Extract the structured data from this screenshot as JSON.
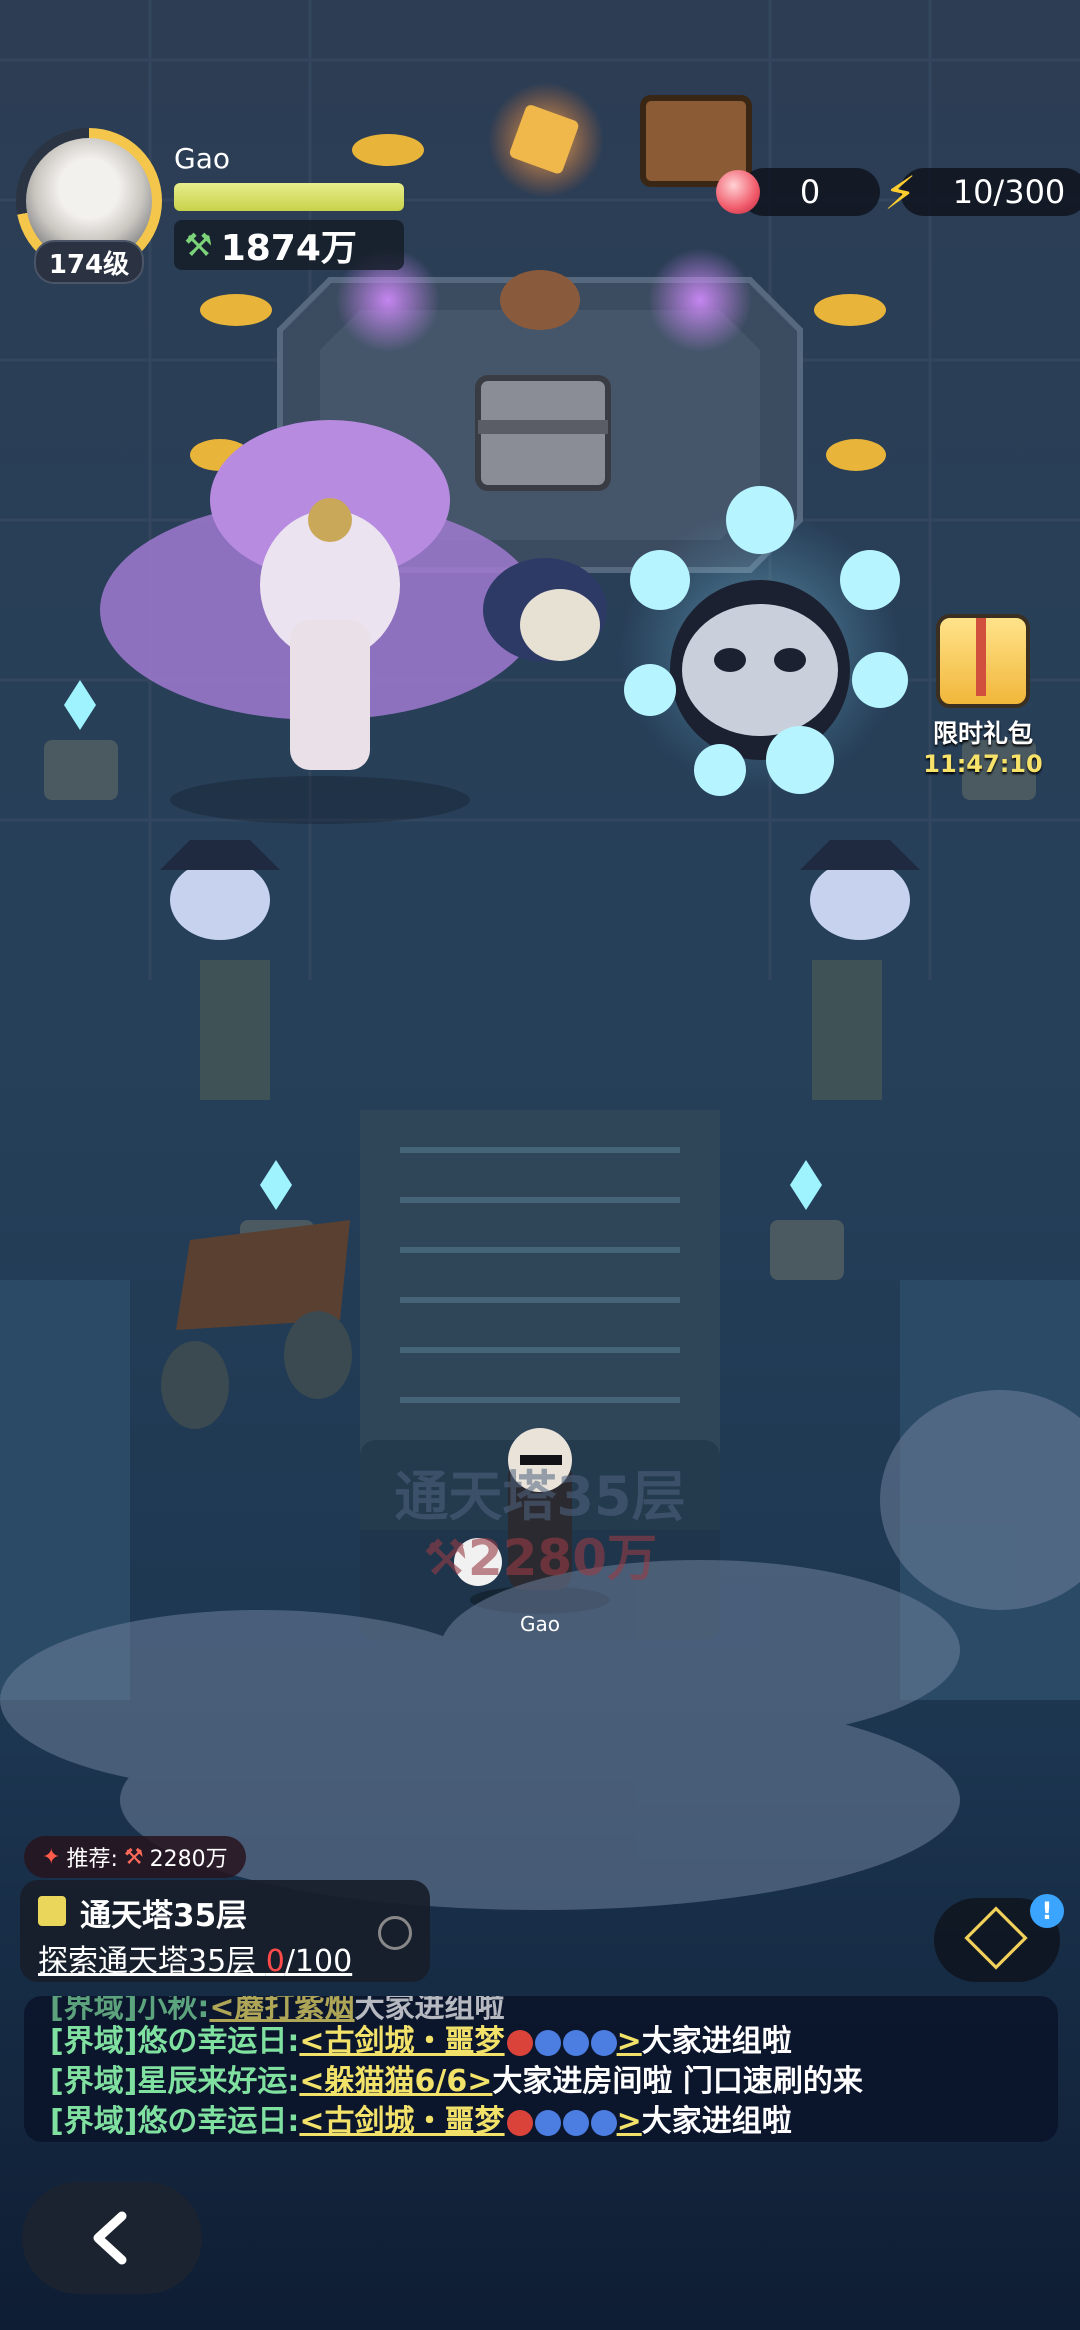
{
  "player": {
    "name": "Gao",
    "level": "174级",
    "power": "1874万",
    "hp_fraction": 1.0
  },
  "resources": {
    "peach_count": "0",
    "energy": "10/300"
  },
  "gift": {
    "title": "限时礼包",
    "timer": "11:47:10"
  },
  "hero": {
    "name": "Gao"
  },
  "floor_sign": {
    "line1": "通天塔35层",
    "line2": "⚒2280万"
  },
  "recommend": {
    "label": "推荐:",
    "power": "2280万"
  },
  "task": {
    "title": "通天塔35层",
    "desc_prefix": "探索通天塔35层 ",
    "progress_current": "0",
    "progress_total": "/100"
  },
  "chat": [
    {
      "channel": "[界域]",
      "user": "小秋:",
      "link": "<蘑打紫烟",
      "text": "大家进组啦"
    },
    {
      "channel": "[界域]",
      "user": "悠の幸运日:",
      "link": "<古剑城・噩梦",
      "text": "大家进组啦"
    },
    {
      "channel": "[界域]",
      "user": "星辰来好运:",
      "link": "<躲猫猫6/6>",
      "text": "大家进房间啦 门口速刷的来"
    },
    {
      "channel": "[界域]",
      "user": "悠の幸运日:",
      "link": "<古剑城・噩梦",
      "text": "大家进组啦"
    }
  ],
  "colors": {
    "accent_gold": "#f4c64b",
    "chat_green": "#7fe0a0",
    "link_yellow": "#f3e26a",
    "danger_red": "#ff4a4a"
  },
  "icons": [
    "peach-icon",
    "lightning-icon",
    "power-icon",
    "gift-icon",
    "task-icon",
    "target-icon",
    "cube-icon",
    "back-arrow-icon",
    "alert-icon"
  ]
}
